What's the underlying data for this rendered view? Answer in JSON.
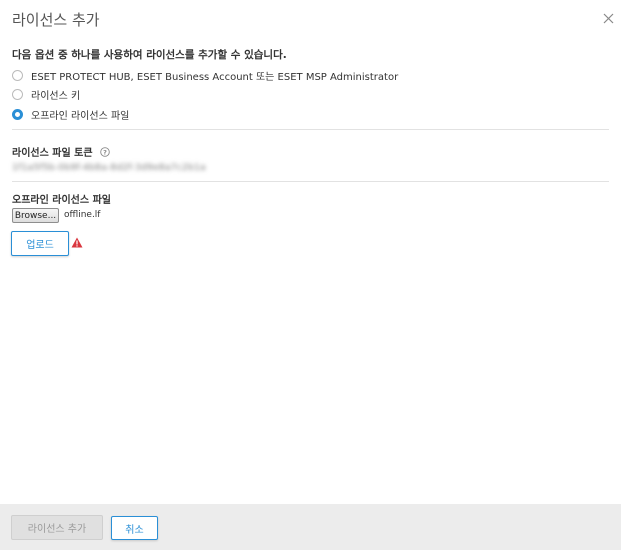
{
  "dialog": {
    "title": "라이선스 추가",
    "close_icon": "close-icon"
  },
  "options": {
    "intro": "다음 옵션 중 하나를 사용하여 라이선스를 추가할 수 있습니다.",
    "items": [
      {
        "label": "ESET PROTECT HUB, ESET Business Account 또는 ESET MSP Administrator",
        "selected": false
      },
      {
        "label": "라이선스 키",
        "selected": false
      },
      {
        "label": "오프라인 라이선스 파일",
        "selected": true
      }
    ]
  },
  "token": {
    "label": "라이선스 파일 토큰",
    "help_icon": "help-circle-icon",
    "value": "1f1a5f5b-0b9f-4b8a-8d2f-3d9e8a7c2b1a"
  },
  "file": {
    "label": "오프라인 라이선스 파일",
    "browse_label": "Browse...",
    "filename": "offline.lf"
  },
  "upload": {
    "label": "업로드",
    "warning_icon": "warning-triangle-icon"
  },
  "footer": {
    "add_label": "라이선스 추가",
    "cancel_label": "취소"
  },
  "colors": {
    "accent": "#2a8fd6",
    "warning": "#d9363e",
    "footer_bg": "#ececec"
  }
}
